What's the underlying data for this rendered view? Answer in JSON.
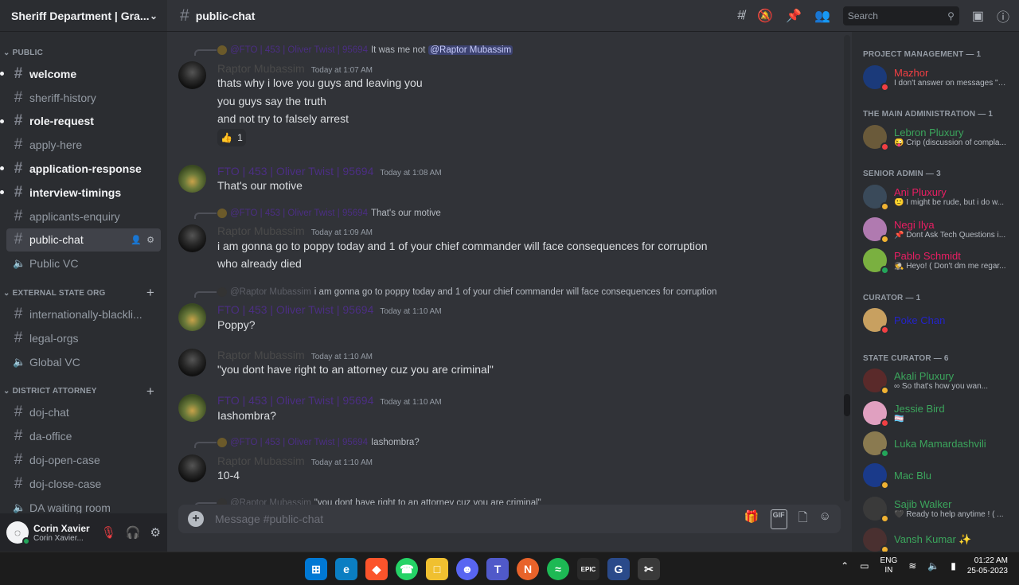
{
  "server": {
    "name": "Sheriff Department | Gra..."
  },
  "categories": {
    "public": "PUBLIC",
    "external": "EXTERNAL STATE ORG",
    "district": "DISTRICT ATTORNEY"
  },
  "channels": [
    "welcome",
    "sheriff-history",
    "role-request",
    "apply-here",
    "application-response",
    "interview-timings",
    "applicants-enquiry",
    "public-chat",
    "Public VC",
    "internationally-blackli...",
    "legal-orgs",
    "Global VC",
    "doj-chat",
    "da-office",
    "doj-open-case",
    "doj-close-case",
    "DA waiting room"
  ],
  "user": {
    "name": "Corin Xavier",
    "tag": "Corin Xavier..."
  },
  "topbar": {
    "channel": "public-chat",
    "search_placeholder": "Search"
  },
  "messages": {
    "m1_reply_name": "@FTO | 453 | Oliver Twist | 95694",
    "m1_reply_text": "It was me not",
    "m1_reply_mention": "@Raptor Mubassim",
    "m1_author": "Raptor Mubassim",
    "m1_time": "Today at 1:07 AM",
    "m1_l1": "thats why i love you guys and leaving you",
    "m1_l2": "you guys say the truth",
    "m1_l3": "and not try to falsely arrest",
    "m1_react_emoji": "👍",
    "m1_react_count": "1",
    "m2_author": "FTO | 453 | Oliver Twist | 95694",
    "m2_time": "Today at 1:08 AM",
    "m2_l1": "That's our motive",
    "m3_reply_name": "@FTO | 453 | Oliver Twist | 95694",
    "m3_reply_text": "That's our motive",
    "m3_author": "Raptor Mubassim",
    "m3_time": "Today at 1:09 AM",
    "m3_l1": "i am gonna go to poppy today and 1 of your chief commander will face consequences for corruption",
    "m3_l2": "who already died",
    "m4_reply_name": "@Raptor Mubassim",
    "m4_reply_text": "i am gonna go to poppy today and 1 of your chief commander will face consequences for corruption",
    "m4_author": "FTO | 453 | Oliver Twist | 95694",
    "m4_time": "Today at 1:10 AM",
    "m4_l1": "Poppy?",
    "m5_author": "Raptor Mubassim",
    "m5_time": "Today at 1:10 AM",
    "m5_l1": "\"you dont have right to an attorney cuz you are criminal\"",
    "m6_author": "FTO | 453 | Oliver Twist | 95694",
    "m6_time": "Today at 1:10 AM",
    "m6_l1": "Iashombra?",
    "m7_reply_name": "@FTO | 453 | Oliver Twist | 95694",
    "m7_reply_text": "Iashombra?",
    "m7_author": "Raptor Mubassim",
    "m7_time": "Today at 1:10 AM",
    "m7_l1": "10-4",
    "m8_reply_name": "@Raptor Mubassim",
    "m8_reply_text": "\"you dont have right to an attorney cuz you are criminal\""
  },
  "composer": {
    "placeholder": "Message #public-chat"
  },
  "members": {
    "cat1": "PROJECT MANAGEMENT — 1",
    "cat2": "THE MAIN ADMINISTRATION — 1",
    "cat3": "SENIOR ADMIN — 3",
    "cat4": "CURATOR — 1",
    "cat5": "STATE CURATOR — 6",
    "list": [
      {
        "name": "Mazhor",
        "status": "I don't answer on messages \"H...",
        "color": "#f23f43"
      },
      {
        "name": "Lebron Pluxury",
        "status": "😜 Crip (discussion of compla...",
        "color": "#3ba55c"
      },
      {
        "name": "Ani Pluxury",
        "status": "🙂 I might be rude, but i do w...",
        "color": "#e91e63"
      },
      {
        "name": "Negi Ilya",
        "status": "📌 Dont Ask Tech Questions i...",
        "color": "#e91e63"
      },
      {
        "name": "Pablo Schmidt",
        "status": "🕵 Heyo! ( Don't dm me regar...",
        "color": "#e91e63"
      },
      {
        "name": "Poke Chan",
        "status": "",
        "color": "#2323c8"
      },
      {
        "name": "Akali Pluxury",
        "status": "∞ So that's how you wan...",
        "color": "#3ba55c"
      },
      {
        "name": "Jessie Bird",
        "status": "🏳️‍⚧️",
        "color": "#3ba55c"
      },
      {
        "name": "Luka Mamardashvili",
        "status": "",
        "color": "#3ba55c"
      },
      {
        "name": "Mac Blu",
        "status": "",
        "color": "#3ba55c"
      },
      {
        "name": "Sajib Walker",
        "status": "🖤 Ready to help anytime ! ( ...",
        "color": "#3ba55c"
      },
      {
        "name": "Vansh Kumar ✨",
        "status": "",
        "color": "#3ba55c"
      }
    ]
  },
  "taskbar": {
    "lang1": "ENG",
    "lang2": "IN",
    "time": "01:22 AM",
    "date": "25-05-2023"
  }
}
